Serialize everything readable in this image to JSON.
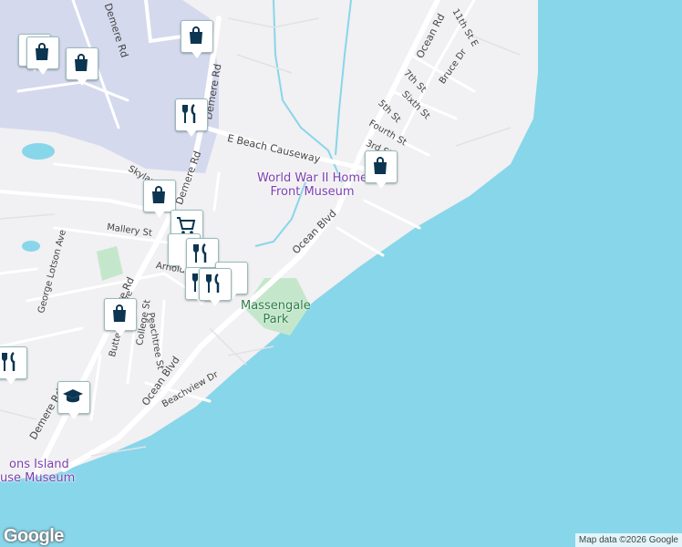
{
  "attribution": "Map data ©2026 Google",
  "logo": "Google",
  "colors": {
    "water": "#88d6ea",
    "land": "#f1f0f2",
    "airport": "#d4d9ee",
    "park": "#c4e7cb",
    "road": "#ffffff",
    "marker_icon": "#0b3550",
    "poi_text": "#7b3fb1"
  },
  "roads": [
    "Demere Rd",
    "Demere Rd",
    "Demere Rd",
    "Demere Rd",
    "E Beach Causeway",
    "Skylane",
    "Mallery St",
    "Arnold",
    "George Lotson Ave",
    "Ocean Blvd",
    "Ocean Blvd",
    "Ocean Rd",
    "11th St E",
    "7th St",
    "Bruce Dr",
    "Sixth St",
    "5th St",
    "Fourth St",
    "3rd St",
    "Peachtree St",
    "College St",
    "Butterman Ave",
    "Beachview Dr"
  ],
  "pois": {
    "museum_line1": "World War II Home",
    "museum_line2": "Front Museum",
    "lighthouse_line1": "ons Island",
    "lighthouse_line2": "use Museum",
    "park_line1": "Massengale",
    "park_line2": "Park"
  },
  "markers": [
    {
      "icon": "shopping-bag"
    },
    {
      "icon": "shopping-bag"
    },
    {
      "icon": "shopping-bag"
    },
    {
      "icon": "restaurant"
    },
    {
      "icon": "shopping-bag"
    },
    {
      "icon": "shopping-cart"
    },
    {
      "icon": "restaurant"
    },
    {
      "icon": "restaurant"
    },
    {
      "icon": "restaurant"
    },
    {
      "icon": "restaurant"
    },
    {
      "icon": "restaurant"
    },
    {
      "icon": "shopping-bag"
    },
    {
      "icon": "shopping-bag"
    },
    {
      "icon": "restaurant"
    },
    {
      "icon": "school"
    }
  ]
}
